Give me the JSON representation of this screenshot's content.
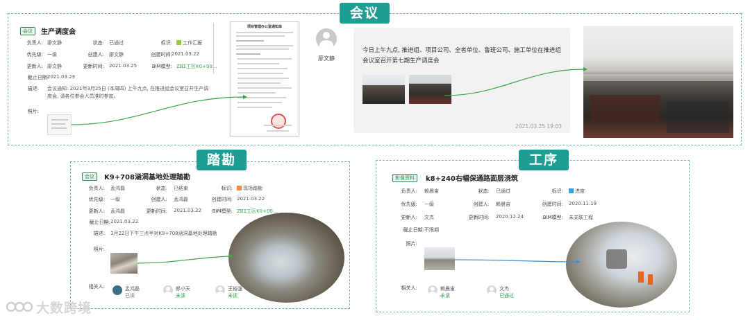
{
  "colors": {
    "accent": "#1e9d92",
    "border": "#6cbf8f",
    "link_line": "#3aa64a",
    "blue_line": "#3a8fd6",
    "status_green": "#2ea44f"
  },
  "meeting": {
    "tab_label": "会议",
    "card": {
      "tag": "会议",
      "title": "生产调度会",
      "fields": [
        {
          "label": "负责人:",
          "value": "廖文静"
        },
        {
          "label": "状态:",
          "value": "已通过"
        },
        {
          "label": "标识:",
          "value": "工作汇报",
          "icon": "green-square-icon"
        },
        {
          "label": "优先级:",
          "value": "一级"
        },
        {
          "label": "创建人:",
          "value": "廖文静"
        },
        {
          "label": "创建时间:",
          "value": "2021.03.22"
        },
        {
          "label": "更新人:",
          "value": "廖文静"
        },
        {
          "label": "更新时间:",
          "value": "2021.03.25"
        },
        {
          "label": "BIM模型:",
          "value": "ZB1工区K0+00...",
          "link": true
        },
        {
          "label": "截止日期:",
          "value": "2021.03.23"
        }
      ],
      "description_label": "描述:",
      "description": "会议通知: 2021年3月25日 (本周四) 上午九点, 在推进组会议室召开生产调度会, 请各位参会人员准时参加。",
      "photo_label": "照片:"
    },
    "document": {
      "title": "项目管理办公室通知单",
      "stamp_icon": "red-seal-icon"
    },
    "poster": {
      "name": "廖文静",
      "avatar_icon": "user-avatar-icon"
    },
    "post": {
      "text": "今日上午九点, 推进组、项目公司、全者单位、鲁班公司、施工单位在推进组会议室召开第七期生产调度会",
      "time": "2021.03.25 19:03"
    }
  },
  "survey": {
    "tab_label": "踏勘",
    "card": {
      "tag": "会议",
      "title": "K9+708涵洞基地处理踏勘",
      "fields": [
        {
          "label": "负责人:",
          "value": "孟鸿磊"
        },
        {
          "label": "状态:",
          "value": "已结束"
        },
        {
          "label": "标识:",
          "value": "现场踏勘",
          "icon": "orange-square-icon"
        },
        {
          "label": "优先级:",
          "value": "一级"
        },
        {
          "label": "创建人:",
          "value": "孟鸿磊"
        },
        {
          "label": "创建时间:",
          "value": "2021.03.22"
        },
        {
          "label": "更新人:",
          "value": "孟鸿磊"
        },
        {
          "label": "更新时间:",
          "value": "2021.03.22"
        },
        {
          "label": "BIM模型:",
          "value": "ZB1工区K0+00...",
          "link": true
        },
        {
          "label": "截止日期:",
          "value": "2021.03.22"
        }
      ],
      "description_label": "描述:",
      "description": "3月22日下午三点半对K9+708涵洞基地处理踏勘",
      "photo_label": "照片:",
      "related_label": "相关人:",
      "related": [
        {
          "name": "孟鸿磊",
          "status": "已读"
        },
        {
          "name": "郎小天",
          "status": "未读"
        },
        {
          "name": "王裕强",
          "status": "未读"
        }
      ]
    }
  },
  "process": {
    "tab_label": "工序",
    "card": {
      "tag": "影像资料",
      "title": "k8+240右幅保通路面层浇筑",
      "fields": [
        {
          "label": "负责人:",
          "value": "赖晨宙"
        },
        {
          "label": "状态:",
          "value": "已通过"
        },
        {
          "label": "标识:",
          "value": "进度",
          "icon": "blue-square-icon"
        },
        {
          "label": "优先级:",
          "value": "一级"
        },
        {
          "label": "创建人:",
          "value": "赖晨宙"
        },
        {
          "label": "创建时间:",
          "value": "2020.11.19"
        },
        {
          "label": "更新人:",
          "value": "文杰"
        },
        {
          "label": "更新时间:",
          "value": "2020.12.24"
        },
        {
          "label": "BIM模型:",
          "value": "未关联工程"
        },
        {
          "label": "截止日期:",
          "value": "不限期"
        }
      ],
      "photo_label": "照片:",
      "related_label": "相关人:",
      "related": [
        {
          "name": "赖晨宙",
          "status": "未读"
        },
        {
          "name": "文杰",
          "status": "已通过"
        }
      ]
    }
  },
  "watermark": {
    "text": "大数跨境",
    "icon": "watermark-logo-icon"
  }
}
